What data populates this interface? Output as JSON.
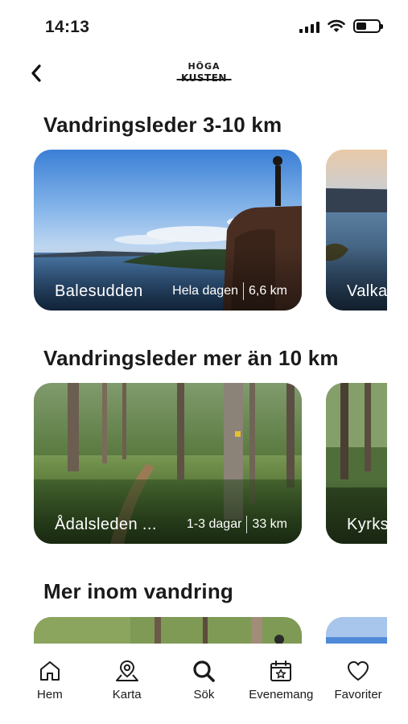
{
  "status_bar": {
    "time": "14:13"
  },
  "nav": {
    "logo_top": "HÖGA",
    "logo_bottom": "KUSTEN"
  },
  "sections": [
    {
      "title": "Vandringsleder 3-10 km",
      "cards": [
        {
          "name": "Balesudden",
          "duration": "Hela dagen",
          "distance": "6,6 km"
        },
        {
          "name": "Valka"
        }
      ]
    },
    {
      "title": "Vandringsleder mer än 10 km",
      "cards": [
        {
          "name": "Ådalsleden ...",
          "duration": "1-3 dagar",
          "distance": "33 km"
        },
        {
          "name": "Kyrks"
        }
      ]
    },
    {
      "title": "Mer inom vandring"
    }
  ],
  "tab_bar": {
    "items": [
      {
        "label": "Hem",
        "icon": "home-icon"
      },
      {
        "label": "Karta",
        "icon": "map-pin-icon"
      },
      {
        "label": "Sök",
        "icon": "search-icon"
      },
      {
        "label": "Evenemang",
        "icon": "calendar-star-icon"
      },
      {
        "label": "Favoriter",
        "icon": "heart-icon"
      }
    ]
  }
}
